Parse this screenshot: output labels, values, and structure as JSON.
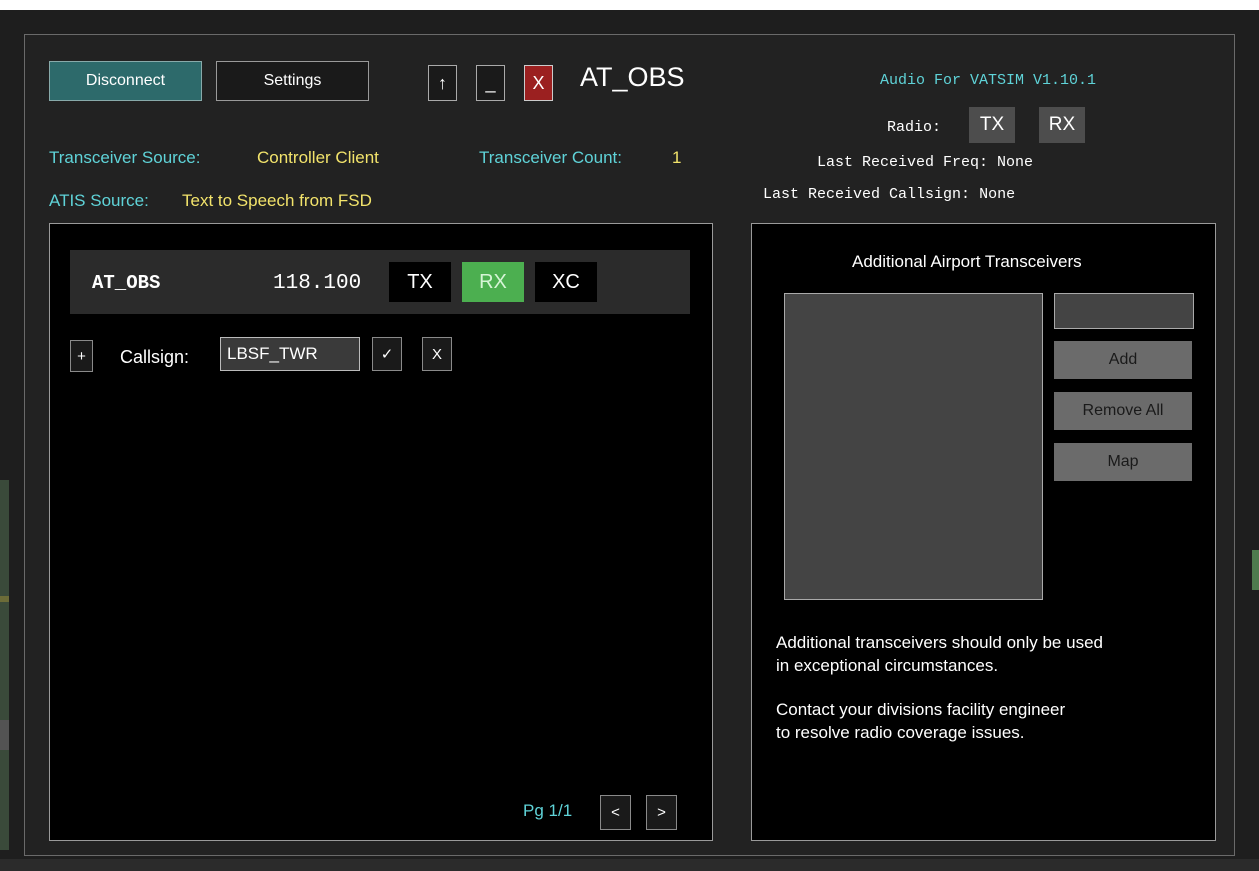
{
  "toolbar": {
    "disconnect_label": "Disconnect",
    "settings_label": "Settings",
    "up_label": "↑",
    "minimize_label": "_",
    "close_label": "X",
    "window_title": "AT_OBS"
  },
  "status": {
    "transceiver_source_label": "Transceiver Source:",
    "transceiver_source_value": "Controller Client",
    "transceiver_count_label": "Transceiver Count:",
    "transceiver_count_value": "1",
    "atis_source_label": "ATIS Source:",
    "atis_source_value": "Text to Speech from FSD"
  },
  "audio_info": {
    "version": "Audio For VATSIM V1.10.1",
    "radio_label": "Radio:",
    "radio_tx": "TX",
    "radio_rx": "RX",
    "last_freq_label": "Last Received Freq:",
    "last_freq_value": "None",
    "last_callsign_label": "Last Received Callsign:",
    "last_callsign_value": "None"
  },
  "station": {
    "callsign": "AT_OBS",
    "frequency": "118.100",
    "tx_label": "TX",
    "rx_label": "RX",
    "xc_label": "XC",
    "rx_active": true
  },
  "callsign_editor": {
    "add_label": "+",
    "label": "Callsign:",
    "value": "LBSF_TWR",
    "confirm_label": "✓",
    "cancel_label": "X"
  },
  "pagination": {
    "page_label": "Pg 1/1",
    "prev_label": "<",
    "next_label": ">"
  },
  "additional": {
    "title": "Additional Airport Transceivers",
    "input_value": "",
    "add_label": "Add",
    "remove_all_label": "Remove All",
    "map_label": "Map",
    "note1_line1": "Additional transceivers should only be used",
    "note1_line2": "in exceptional circumstances.",
    "note2_line1": "Contact your divisions facility engineer",
    "note2_line2": "to resolve radio coverage issues."
  },
  "colors": {
    "accent_cyan": "#5fd3d8",
    "accent_yellow": "#f2e36b",
    "rx_active_green": "#4caf50",
    "disconnect_teal": "#2d6a6b",
    "close_red": "#9b2020"
  }
}
